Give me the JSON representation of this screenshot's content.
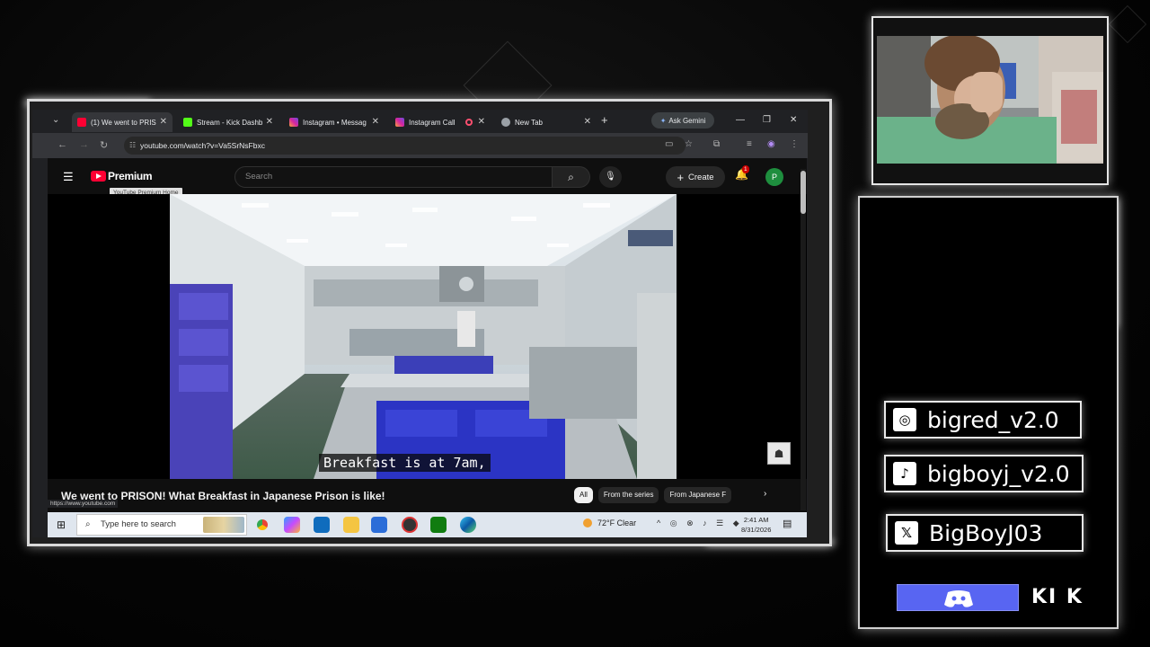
{
  "browser": {
    "tabs": [
      {
        "title": "(1) We went to PRIS",
        "favicon": "youtube-icon",
        "active": true
      },
      {
        "title": "Stream - Kick Dashb",
        "favicon": "kick-icon",
        "active": false
      },
      {
        "title": "Instagram • Messag",
        "favicon": "instagram-icon",
        "active": false
      },
      {
        "title": "Instagram Call",
        "favicon": "instagram-icon",
        "active": false,
        "recording": true
      },
      {
        "title": "New Tab",
        "favicon": "chrome-icon",
        "active": false
      }
    ],
    "new_tab_symbol": "+",
    "ask_gemini_label": "Ask Gemini",
    "url": "youtube.com/watch?v=Va5SrNsFbxc"
  },
  "youtube": {
    "brand_label": "Premium",
    "logo_tooltip": "YouTube Premium Home",
    "search_placeholder": "Search",
    "create_label": "Create",
    "notification_count": "1",
    "avatar_letter": "P",
    "caption": "Breakfast is at 7am,",
    "video_title": "We went to PRISON! What Breakfast in Japanese Prison is like!",
    "chips": [
      "All",
      "From the series",
      "From Japanese F"
    ],
    "status_url": "https://www.youtube.com"
  },
  "taskbar": {
    "search_placeholder": "Type here to search",
    "weather": "72°F  Clear",
    "time": "2:41 AM",
    "date": "8/31/2026"
  },
  "socials": [
    {
      "platform": "instagram",
      "handle": "bigred_v2.0"
    },
    {
      "platform": "tiktok",
      "handle": "bigboyj_v2.0"
    },
    {
      "platform": "x",
      "handle": "BigBoyJ03"
    }
  ],
  "kick_logo_text": "KI K",
  "colors": {
    "youtube_red": "#ff0033",
    "discord_blurple": "#5865f2",
    "avatar_green": "#1e8e3e",
    "chrome_dark": "#202124"
  }
}
